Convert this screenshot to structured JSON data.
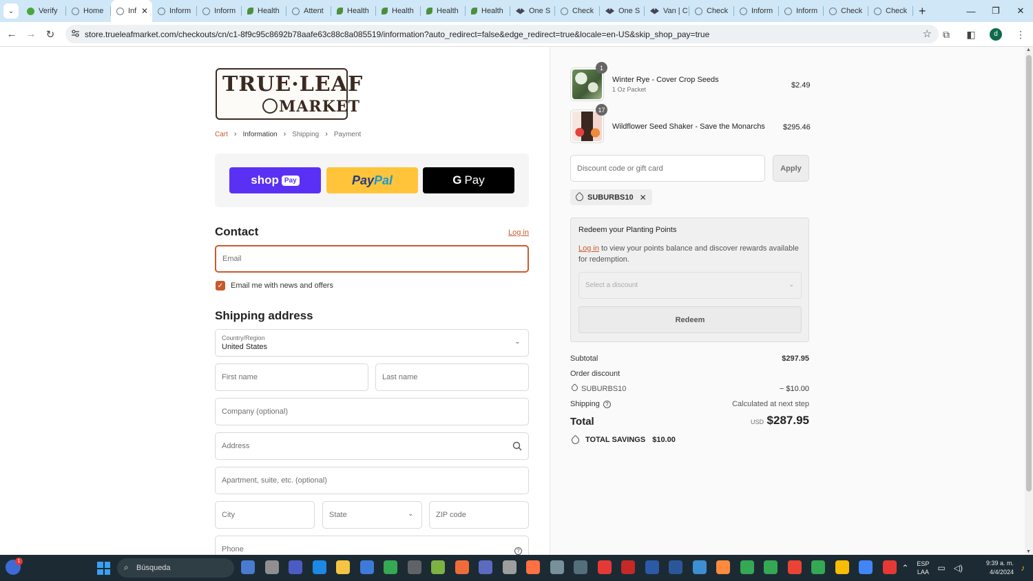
{
  "browser": {
    "tabs": [
      {
        "label": "Verify",
        "icon": "shield-icon"
      },
      {
        "label": "Home",
        "icon": "globe-icon"
      },
      {
        "label": "Inf",
        "icon": "globe-icon",
        "active": true
      },
      {
        "label": "Inform",
        "icon": "globe-icon"
      },
      {
        "label": "Inform",
        "icon": "globe-icon"
      },
      {
        "label": "Health",
        "icon": "leaf-icon"
      },
      {
        "label": "Attent",
        "icon": "globe-icon"
      },
      {
        "label": "Health",
        "icon": "leaf-icon"
      },
      {
        "label": "Health",
        "icon": "leaf-icon"
      },
      {
        "label": "Health",
        "icon": "leaf-icon"
      },
      {
        "label": "Health",
        "icon": "leaf-icon"
      },
      {
        "label": "One S",
        "icon": "wing-icon"
      },
      {
        "label": "Check",
        "icon": "globe-icon"
      },
      {
        "label": "One S",
        "icon": "wing-icon"
      },
      {
        "label": "Van | C",
        "icon": "wing-icon"
      },
      {
        "label": "Check",
        "icon": "globe-icon"
      },
      {
        "label": "Inform",
        "icon": "globe-icon"
      },
      {
        "label": "Inform",
        "icon": "globe-icon"
      },
      {
        "label": "Check",
        "icon": "globe-icon"
      },
      {
        "label": "Check",
        "icon": "globe-icon"
      }
    ],
    "url": "store.trueleafmarket.com/checkouts/cn/c1-8f9c95c8692b78aafe63c88c8a085519/information?auto_redirect=false&edge_redirect=true&locale=en-US&skip_shop_pay=true",
    "profile_initial": "d"
  },
  "logo": {
    "top": "TRUE·LEAF",
    "bottom": "MARKET"
  },
  "breadcrumb": {
    "cart": "Cart",
    "information": "Information",
    "shipping": "Shipping",
    "payment": "Payment"
  },
  "express": {
    "shop": "shop",
    "shop_pill": "Pay",
    "paypal_a": "Pay",
    "paypal_b": "Pal",
    "gpay_g": "G",
    "gpay": "Pay"
  },
  "contact": {
    "title": "Contact",
    "login": "Log in",
    "email_placeholder": "Email",
    "newsletter": "Email me with news and offers"
  },
  "shipping": {
    "title": "Shipping address",
    "country_label": "Country/Region",
    "country_value": "United States",
    "first_name": "First name",
    "last_name": "Last name",
    "company": "Company (optional)",
    "address": "Address",
    "apartment": "Apartment, suite, etc. (optional)",
    "city": "City",
    "state": "State",
    "zip": "ZIP code",
    "phone": "Phone"
  },
  "cart": {
    "items": [
      {
        "name": "Winter Rye - Cover Crop Seeds",
        "variant": "1 Oz Packet",
        "qty": "1",
        "price": "$2.49"
      },
      {
        "name": "Wildflower Seed Shaker - Save the Monarchs",
        "variant": "",
        "qty": "17",
        "price": "$295.46"
      }
    ]
  },
  "discount": {
    "placeholder": "Discount code or gift card",
    "apply": "Apply",
    "code": "SUBURBS10"
  },
  "redeem": {
    "title": "Redeem your Planting Points",
    "login": "Log in",
    "text": " to view your points balance and discover rewards available for redemption.",
    "select_placeholder": "Select a discount",
    "button": "Redeem"
  },
  "totals": {
    "subtotal_label": "Subtotal",
    "subtotal": "$297.95",
    "order_discount_label": "Order discount",
    "discount_code": "SUBURBS10",
    "discount_amount": "− $10.00",
    "shipping_label": "Shipping",
    "shipping_value": "Calculated at next step",
    "total_label": "Total",
    "currency": "USD",
    "total": "$287.95",
    "savings_label": "TOTAL SAVINGS",
    "savings": "$10.00"
  },
  "taskbar": {
    "search": "Búsqueda",
    "lang_top": "ESP",
    "lang_bottom": "LAA",
    "time": "9:39 a. m.",
    "date": "4/4/2024",
    "widget_badge": "1"
  },
  "colors": {
    "accent": "#c85a2b",
    "shop_pay": "#5a31f4",
    "paypal": "#ffc439",
    "tabbar": "#cfe7f7"
  }
}
